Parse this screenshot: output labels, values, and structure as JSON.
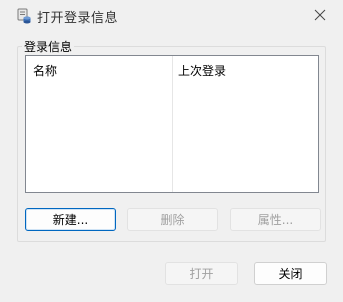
{
  "window": {
    "title": "打开登录信息",
    "app_icon": "database-icon",
    "close_icon": "close-icon"
  },
  "group": {
    "label": "登录信息"
  },
  "list": {
    "columns": [
      "名称",
      "上次登录"
    ],
    "rows": []
  },
  "buttons": {
    "new": "新建...",
    "delete": "删除",
    "properties": "属性...",
    "open": "打开",
    "close": "关闭"
  }
}
